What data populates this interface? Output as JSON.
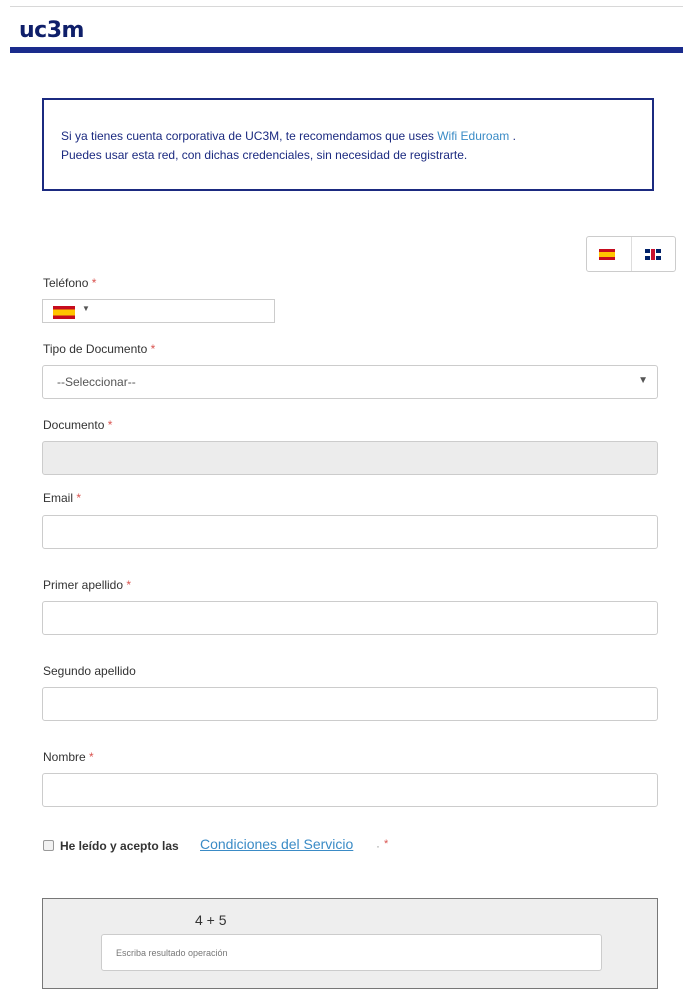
{
  "header": {
    "logo": "uc3m",
    "brand_color": "#1a2b8c"
  },
  "notice": {
    "line1_text": "Si ya tienes cuenta corporativa de UC3M, te recomendamos que uses",
    "link": "Wifi Eduroam",
    "line1_end": ".",
    "line2": "Puedes usar esta red, con dichas credenciales, sin necesidad de registrarte."
  },
  "language": {
    "options": [
      "es-flag-icon",
      "uk-flag-icon"
    ]
  },
  "form": {
    "phone": {
      "label": "Teléfono",
      "required": "*",
      "country_icon": "es-flag-icon",
      "caret": "▼",
      "value": ""
    },
    "doc_type": {
      "label": "Tipo de Documento",
      "required": "*",
      "selected": "--Seleccionar--",
      "caret": "▼"
    },
    "document": {
      "label": "Documento",
      "required": "*",
      "value": ""
    },
    "email": {
      "label": "Email",
      "required": "*",
      "value": ""
    },
    "surname1": {
      "label": "Primer apellido",
      "required": "*",
      "value": ""
    },
    "surname2": {
      "label": "Segundo apellido",
      "value": ""
    },
    "name": {
      "label": "Nombre",
      "required": "*",
      "value": ""
    },
    "terms": {
      "text": "He leído y acepto las",
      "link": "Condiciones del Servicio",
      "dot": "·",
      "required": "*"
    },
    "captcha": {
      "operation": "4 + 5",
      "placeholder": "Escriba resultado operación"
    }
  },
  "colors": {
    "link": "#3a8bc6",
    "required": "#d9534f",
    "notice_border": "#1b2a80"
  }
}
